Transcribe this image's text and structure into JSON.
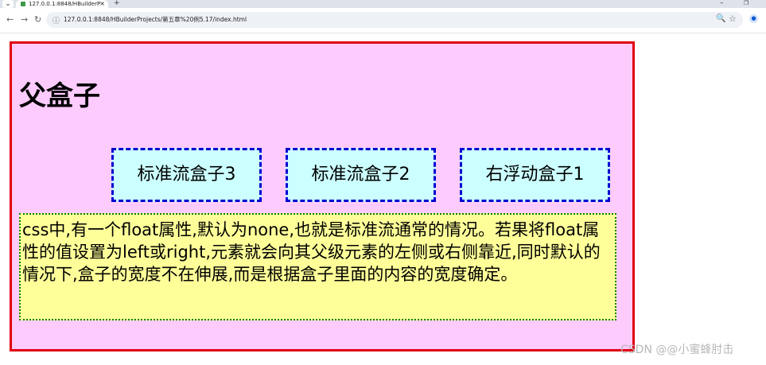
{
  "browser": {
    "tab_dropdown": "⌄",
    "tab_title": "127.0.0.1:8848/HBuilderProj...",
    "tab_close": "×",
    "new_tab": "+",
    "url": "127.0.0.1:8848/HBuilderProjects/第五章%20例5.17/index.html",
    "nav": {
      "back": "←",
      "forward": "→",
      "reload": "↻"
    },
    "site_info_icon": "ⓘ",
    "zoom_icon": "🔍",
    "star_icon": "☆",
    "profile_icon": "●",
    "window_min": "–",
    "window_max": "❐"
  },
  "page": {
    "title": "父盒子",
    "boxes": [
      {
        "label": "标准流盒子3"
      },
      {
        "label": "标准流盒子2"
      },
      {
        "label": "右浮动盒子1"
      }
    ],
    "paragraph": "css中,有一个float属性,默认为none,也就是标准流通常的情况。若果将float属性的值设置为left或right,元素就会向其父级元素的左侧或右侧靠近,同时默认的 情况下,盒子的宽度不在伸展,而是根据盒子里面的内容的宽度确定。"
  },
  "watermark": "CSDN @@小蜜蜂肘击",
  "colors": {
    "parent_bg": "#fecbfe",
    "parent_border": "#e00012",
    "float_bg": "#ccffff",
    "float_border": "#0000d0",
    "text_bg": "#ffff99",
    "text_border": "#008000"
  }
}
